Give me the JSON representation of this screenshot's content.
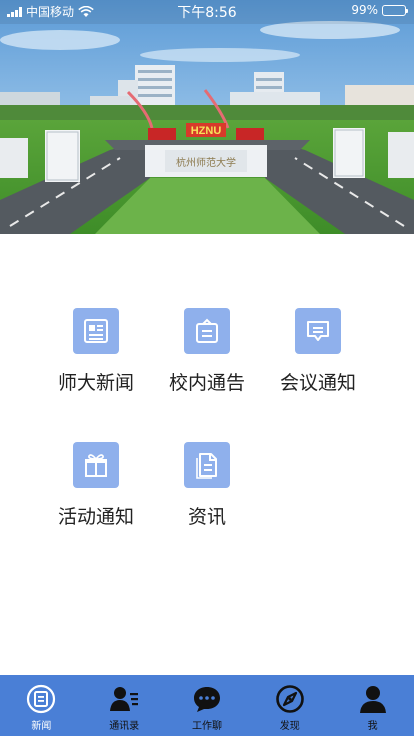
{
  "status_bar": {
    "carrier": "中国移动",
    "time": "下午8:56",
    "battery_text": "99%",
    "battery_level": 0.99
  },
  "hero": {
    "sign_text": "HZNU"
  },
  "menu": {
    "items": [
      {
        "label": "师大新闻",
        "icon": "newspaper-icon"
      },
      {
        "label": "校内通告",
        "icon": "notice-board-icon"
      },
      {
        "label": "会议通知",
        "icon": "meeting-chat-icon"
      },
      {
        "label": "活动通知",
        "icon": "gift-box-icon"
      },
      {
        "label": "资讯",
        "icon": "document-icon"
      }
    ]
  },
  "tabbar": {
    "items": [
      {
        "label": "新闻",
        "icon": "news-icon",
        "active": true
      },
      {
        "label": "通讯录",
        "icon": "contacts-icon",
        "active": false
      },
      {
        "label": "工作聊",
        "icon": "chat-bubble-icon",
        "active": false
      },
      {
        "label": "发现",
        "icon": "compass-icon",
        "active": false
      },
      {
        "label": "我",
        "icon": "person-icon",
        "active": false
      }
    ]
  },
  "colors": {
    "accent": "#4a7fd6",
    "icon_tile": "#8fb0ec",
    "active_tab_text": "#ffffff"
  }
}
